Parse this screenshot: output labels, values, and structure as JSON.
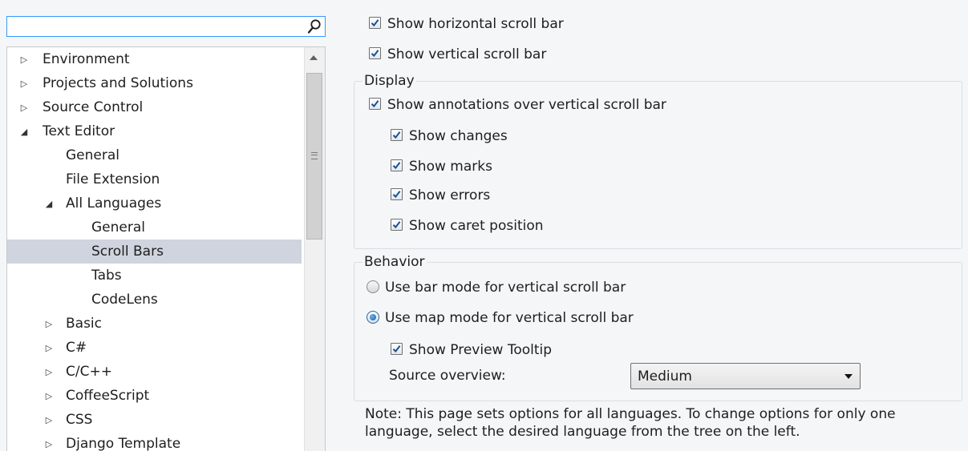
{
  "search": {
    "value": "",
    "icon": "search-icon"
  },
  "tree": {
    "items": [
      {
        "label": "Environment",
        "expander": "▷"
      },
      {
        "label": "Projects and Solutions",
        "expander": "▷"
      },
      {
        "label": "Source Control",
        "expander": "▷"
      },
      {
        "label": "Text Editor",
        "expander": "◢"
      },
      {
        "label": "General",
        "expander": ""
      },
      {
        "label": "File Extension",
        "expander": ""
      },
      {
        "label": "All Languages",
        "expander": "◢"
      },
      {
        "label": "General",
        "expander": ""
      },
      {
        "label": "Scroll Bars",
        "expander": "",
        "selected": true
      },
      {
        "label": "Tabs",
        "expander": ""
      },
      {
        "label": "CodeLens",
        "expander": ""
      },
      {
        "label": "Basic",
        "expander": "▷"
      },
      {
        "label": "C#",
        "expander": "▷"
      },
      {
        "label": "C/C++",
        "expander": "▷"
      },
      {
        "label": "CoffeeScript",
        "expander": "▷"
      },
      {
        "label": "CSS",
        "expander": "▷"
      },
      {
        "label": "Django Template",
        "expander": "▷"
      }
    ]
  },
  "options": {
    "show_horizontal": {
      "label": "Show horizontal scroll bar",
      "checked": true
    },
    "show_vertical": {
      "label": "Show vertical scroll bar",
      "checked": true
    }
  },
  "display": {
    "title": "Display",
    "show_annotations": {
      "label": "Show annotations over vertical scroll bar",
      "checked": true
    },
    "show_changes": {
      "label": "Show changes",
      "checked": true
    },
    "show_marks": {
      "label": "Show marks",
      "checked": true
    },
    "show_errors": {
      "label": "Show errors",
      "checked": true
    },
    "show_caret": {
      "label": "Show caret position",
      "checked": true
    }
  },
  "behavior": {
    "title": "Behavior",
    "bar_mode": {
      "label": "Use bar mode for vertical scroll bar",
      "selected": false
    },
    "map_mode": {
      "label": "Use map mode for vertical scroll bar",
      "selected": true
    },
    "preview_tooltip": {
      "label": "Show Preview Tooltip",
      "checked": true
    },
    "source_overview_label": "Source overview:",
    "source_overview_value": "Medium"
  },
  "note": {
    "line1": "Note: This page sets options for all languages. To change options for only one",
    "line2": "language, select the desired language from the tree on the left."
  },
  "colors": {
    "accent": "#3399ff",
    "selection": "#cfd4de",
    "check": "#1c4f8c"
  }
}
